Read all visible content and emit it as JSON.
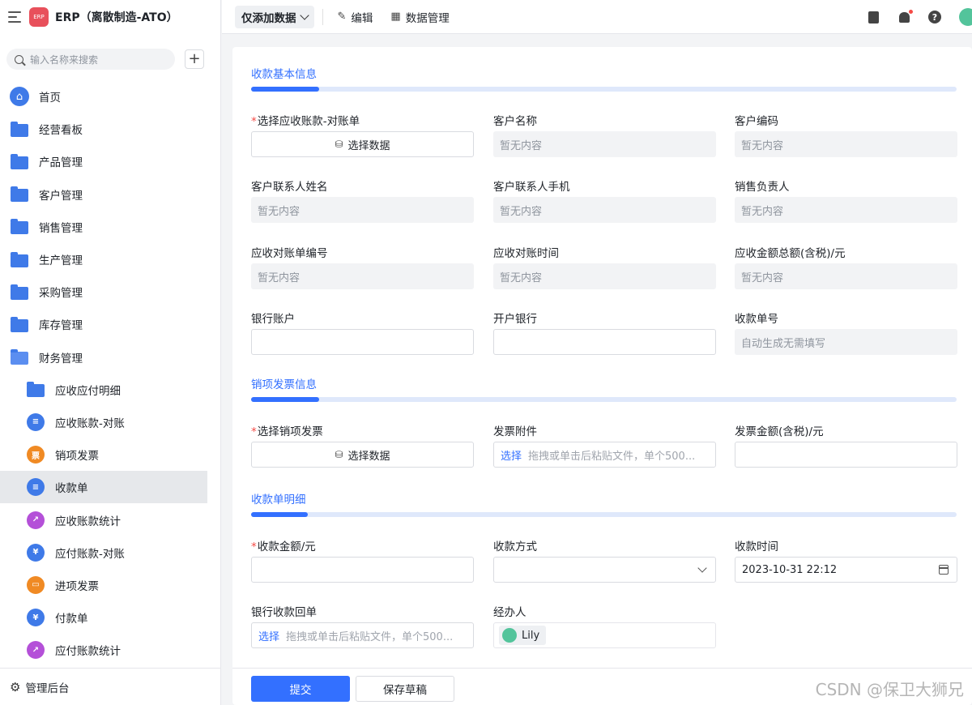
{
  "app": {
    "title": "ERP（离散制造-ATO）",
    "logo_text": "ERP"
  },
  "search": {
    "placeholder": "输入名称来搜索"
  },
  "nav": {
    "items": [
      {
        "label": "首页",
        "icon": "home-icon"
      },
      {
        "label": "经营看板",
        "icon": "folder-icon"
      },
      {
        "label": "产品管理",
        "icon": "folder-icon"
      },
      {
        "label": "客户管理",
        "icon": "folder-icon"
      },
      {
        "label": "销售管理",
        "icon": "folder-icon"
      },
      {
        "label": "生产管理",
        "icon": "folder-icon"
      },
      {
        "label": "采购管理",
        "icon": "folder-icon"
      },
      {
        "label": "库存管理",
        "icon": "folder-icon"
      },
      {
        "label": "财务管理",
        "icon": "folder-open-icon"
      }
    ],
    "sub_items": [
      {
        "label": "应收应付明细",
        "icon": "folder-icon"
      },
      {
        "label": "应收账款-对账",
        "icon": "document-icon",
        "color": "#3f7ae8"
      },
      {
        "label": "销项发票",
        "icon": "invoice-icon",
        "color": "#f08a24"
      },
      {
        "label": "收款单",
        "icon": "document-icon",
        "color": "#3f7ae8",
        "active": true
      },
      {
        "label": "应收账款统计",
        "icon": "chart-icon",
        "color": "#b450d8"
      },
      {
        "label": "应付账款-对账",
        "icon": "money-house-icon",
        "color": "#3f7ae8"
      },
      {
        "label": "进项发票",
        "icon": "card-icon",
        "color": "#f08a24"
      },
      {
        "label": "付款单",
        "icon": "money-house-icon",
        "color": "#3f7ae8"
      },
      {
        "label": "应付账款统计",
        "icon": "chart-icon",
        "color": "#b450d8"
      }
    ],
    "footer": "管理后台"
  },
  "topbar": {
    "view_label": "仅添加数据",
    "edit_label": "编辑",
    "data_manage_label": "数据管理"
  },
  "form": {
    "section1": {
      "title": "收款基本信息"
    },
    "select_statement": {
      "label": "选择应收账款-对账单",
      "button": "选择数据"
    },
    "customer_name": {
      "label": "客户名称",
      "value": "暂无内容"
    },
    "customer_code": {
      "label": "客户编码",
      "value": "暂无内容"
    },
    "contact_name": {
      "label": "客户联系人姓名",
      "value": "暂无内容"
    },
    "contact_phone": {
      "label": "客户联系人手机",
      "value": "暂无内容"
    },
    "sales_owner": {
      "label": "销售负责人",
      "value": "暂无内容"
    },
    "statement_no": {
      "label": "应收对账单编号",
      "value": "暂无内容"
    },
    "statement_time": {
      "label": "应收对账时间",
      "value": "暂无内容"
    },
    "total_amount": {
      "label": "应收金额总额(含税)/元",
      "value": "暂无内容"
    },
    "bank_account": {
      "label": "银行账户",
      "value": ""
    },
    "bank_name": {
      "label": "开户银行",
      "value": ""
    },
    "receipt_no": {
      "label": "收款单号",
      "value": "自动生成无需填写"
    },
    "section2": {
      "title": "销项发票信息"
    },
    "select_invoice": {
      "label": "选择销项发票",
      "button": "选择数据"
    },
    "invoice_attachment": {
      "label": "发票附件",
      "pick": "选择",
      "hint": "拖拽或单击后粘贴文件，单个500..."
    },
    "invoice_amount": {
      "label": "发票金额(含税)/元",
      "value": ""
    },
    "section3": {
      "title": "收款单明细"
    },
    "receipt_amount": {
      "label": "收款金额/元",
      "value": ""
    },
    "payment_method": {
      "label": "收款方式",
      "value": ""
    },
    "receipt_time": {
      "label": "收款时间",
      "value": "2023-10-31 22:12"
    },
    "bank_slip": {
      "label": "银行收款回单",
      "pick": "选择",
      "hint": "拖拽或单击后粘贴文件，单个500..."
    },
    "handler": {
      "label": "经办人",
      "value": "Lily"
    }
  },
  "actions": {
    "submit": "提交",
    "save_draft": "保存草稿"
  },
  "watermark": "CSDN @保卫大狮兄"
}
